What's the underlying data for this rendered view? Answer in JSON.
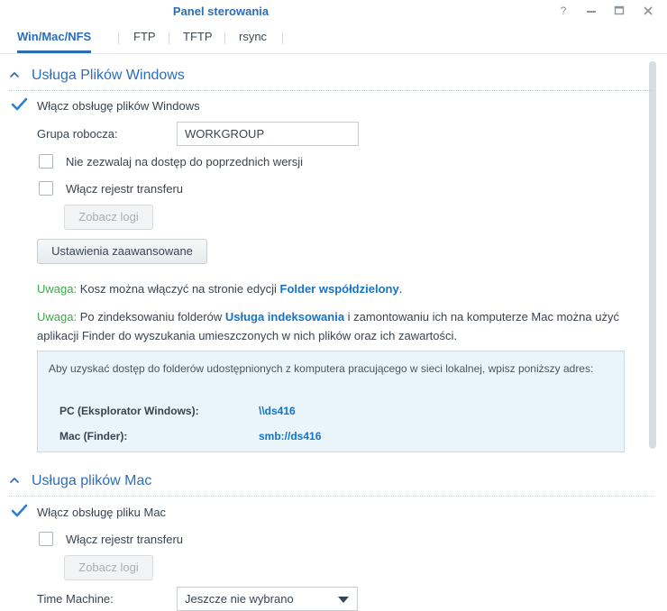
{
  "window": {
    "title": "Panel sterowania",
    "controls": [
      "help-icon",
      "minimize-icon",
      "maximize-icon",
      "close-icon"
    ]
  },
  "tabs": [
    {
      "label": "Win/Mac/NFS",
      "active": true
    },
    {
      "label": "FTP",
      "active": false
    },
    {
      "label": "TFTP",
      "active": false
    },
    {
      "label": "rsync",
      "active": false
    }
  ],
  "windows_section": {
    "title": "Usługa Plików Windows",
    "enable_label": "Włącz obsługę plików Windows",
    "enable_checked": true,
    "workgroup_label": "Grupa robocza:",
    "workgroup_value": "WORKGROUP",
    "no_prev_versions_label": "Nie zezwalaj na dostęp do poprzednich wersji",
    "no_prev_versions_checked": false,
    "transfer_log_label": "Włącz rejestr transferu",
    "transfer_log_checked": false,
    "view_logs_label": "Zobacz logi",
    "advanced_label": "Ustawienia zaawansowane",
    "note1": {
      "prefix": "Uwaga:",
      "text_before": " Kosz można włączyć na stronie edycji ",
      "link": "Folder współdzielony",
      "text_after": "."
    },
    "note2": {
      "prefix": "Uwaga:",
      "text_before": " Po zindeksowaniu folderów ",
      "link": "Usługa indeksowania",
      "text_after": " i zamontowaniu ich na komputerze Mac można użyć aplikacji Finder do wyszukania umieszczonych w nich plików oraz ich zawartości."
    },
    "info": {
      "text": "Aby uzyskać dostęp do folderów udostępnionych z komputera pracującego w sieci lokalnej, wpisz poniższy adres:",
      "pc_label": "PC (Eksplorator Windows):",
      "pc_value": "\\\\ds416",
      "mac_label": "Mac (Finder):",
      "mac_value": "smb://ds416"
    }
  },
  "mac_section": {
    "title": "Usługa plików Mac",
    "enable_label": "Włącz obsługę pliku Mac",
    "enable_checked": true,
    "transfer_log_label": "Włącz rejestr transferu",
    "transfer_log_checked": false,
    "view_logs_label": "Zobacz logi",
    "time_machine_label": "Time Machine:",
    "time_machine_value": "Jeszcze nie wybrano"
  },
  "colors": {
    "accent": "#2c6db5",
    "link": "#1673c8",
    "warning": "#3aa94a",
    "info_bg": "#eaf4fb"
  }
}
